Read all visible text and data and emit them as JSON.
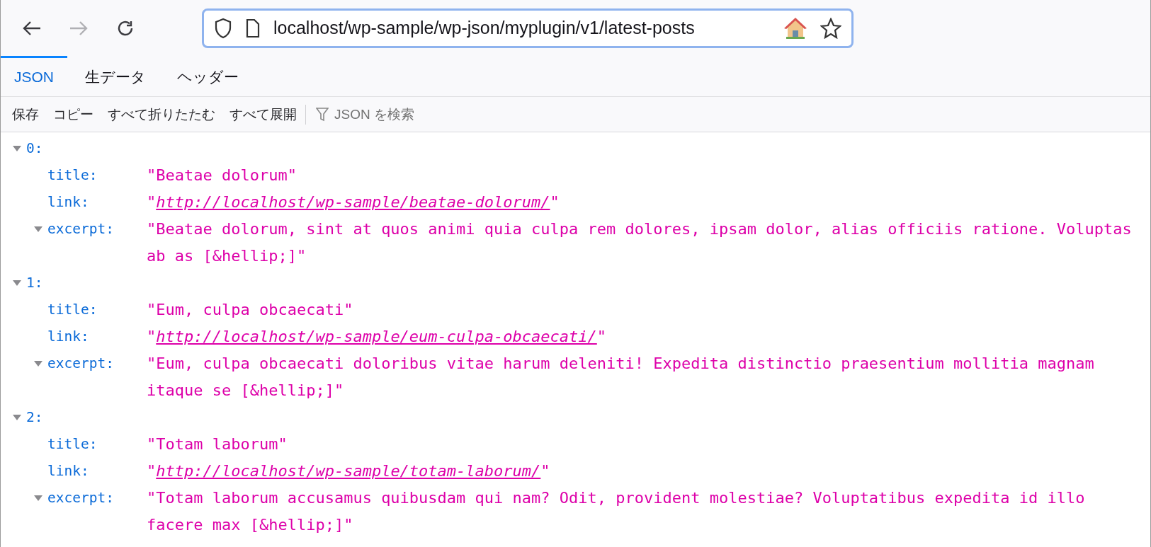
{
  "url_bar": {
    "url": "localhost/wp-sample/wp-json/myplugin/v1/latest-posts"
  },
  "tabs": [
    {
      "label": "JSON",
      "selected": true
    },
    {
      "label": "生データ",
      "selected": false
    },
    {
      "label": "ヘッダー",
      "selected": false
    }
  ],
  "toolbar": {
    "buttons": [
      "保存",
      "コピー",
      "すべて折りたたむ",
      "すべて展開"
    ],
    "filter": {
      "placeholder": "JSON を検索"
    }
  },
  "tree": [
    {
      "key": "0:",
      "expanded": true,
      "children": [
        {
          "key": "title:",
          "kind": "string",
          "value": "\"Beatae dolorum\""
        },
        {
          "key": "link:",
          "kind": "link",
          "open_quote": "\"",
          "value": "http://localhost/wp-sample/beatae-dolorum/",
          "close_quote": "\""
        },
        {
          "key": "excerpt:",
          "kind": "string",
          "expanded": true,
          "value": "\"Beatae dolorum, sint at quos animi quia culpa rem dolores, ipsam dolor, alias officiis ratione. Voluptas ab as [&hellip;]\""
        }
      ]
    },
    {
      "key": "1:",
      "expanded": true,
      "children": [
        {
          "key": "title:",
          "kind": "string",
          "value": "\"Eum, culpa obcaecati\""
        },
        {
          "key": "link:",
          "kind": "link",
          "open_quote": "\"",
          "value": "http://localhost/wp-sample/eum-culpa-obcaecati/",
          "close_quote": "\""
        },
        {
          "key": "excerpt:",
          "kind": "string",
          "expanded": true,
          "value": "\"Eum, culpa obcaecati doloribus vitae harum deleniti! Expedita distinctio praesentium mollitia magnam itaque se [&hellip;]\""
        }
      ]
    },
    {
      "key": "2:",
      "expanded": true,
      "children": [
        {
          "key": "title:",
          "kind": "string",
          "value": "\"Totam laborum\""
        },
        {
          "key": "link:",
          "kind": "link",
          "open_quote": "\"",
          "value": "http://localhost/wp-sample/totam-laborum/",
          "close_quote": "\""
        },
        {
          "key": "excerpt:",
          "kind": "string",
          "expanded": true,
          "value": "\"Totam laborum accusamus quibusdam qui nam? Odit, provident molestiae? Voluptatibus expedita id illo facere max [&hellip;]\""
        }
      ]
    }
  ]
}
